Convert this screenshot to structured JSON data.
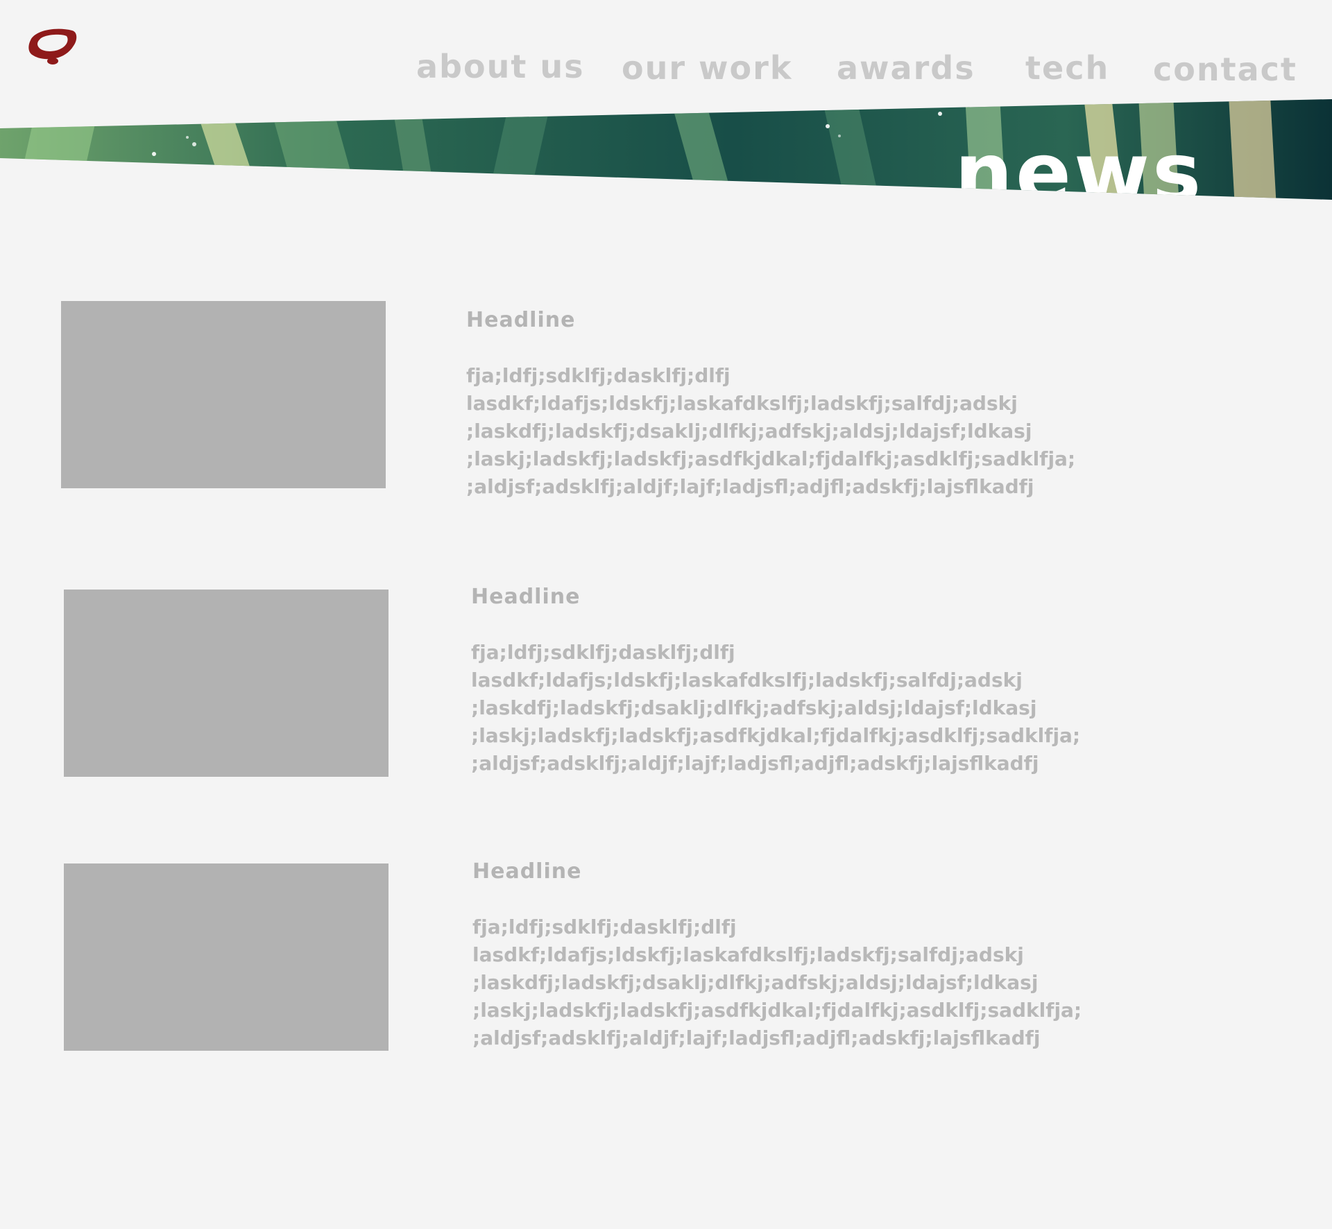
{
  "brand": {
    "logo_icon": "red-ring-logo-icon",
    "logo_color": "#8e1a1a"
  },
  "nav": {
    "items": [
      {
        "label": "about us"
      },
      {
        "label": "our work"
      },
      {
        "label": "awards"
      },
      {
        "label": "tech"
      },
      {
        "label": "contact"
      }
    ],
    "color": "#c9c9c9"
  },
  "banner": {
    "title": "news",
    "colors": [
      "#0e3b3b",
      "#2f6e55",
      "#8cc08a",
      "#e9e2a8"
    ]
  },
  "news": {
    "items": [
      {
        "headline": "Headline",
        "body": [
          "fja;ldfj;sdklfj;dasklfj;dlfj",
          "lasdkf;ldafjs;ldskfj;laskafdkslfj;ladskfj;salfdj;adskj",
          ";laskdfj;ladskfj;dsaklj;dlfkj;adfskj;aldsj;ldajsf;ldkasj",
          ";laskj;ladskfj;ladskfj;asdfkjdkal;fjdalfkj;asdklfj;sadklfja;",
          ";aldjsf;adsklfj;aldjf;lajf;ladjsfl;adjfl;adskfj;lajsflkadfj"
        ]
      },
      {
        "headline": "Headline",
        "body": [
          "fja;ldfj;sdklfj;dasklfj;dlfj",
          "lasdkf;ldafjs;ldskfj;laskafdkslfj;ladskfj;salfdj;adskj",
          ";laskdfj;ladskfj;dsaklj;dlfkj;adfskj;aldsj;ldajsf;ldkasj",
          ";laskj;ladskfj;ladskfj;asdfkjdkal;fjdalfkj;asdklfj;sadklfja;",
          ";aldjsf;adsklfj;aldjf;lajf;ladjsfl;adjfl;adskfj;lajsflkadfj"
        ]
      },
      {
        "headline": "Headline",
        "body": [
          "fja;ldfj;sdklfj;dasklfj;dlfj",
          "lasdkf;ldafjs;ldskfj;laskafdkslfj;ladskfj;salfdj;adskj",
          ";laskdfj;ladskfj;dsaklj;dlfkj;adfskj;aldsj;ldajsf;ldkasj",
          ";laskj;ladskfj;ladskfj;asdfkjdkal;fjdalfkj;asdklfj;sadklfja;",
          ";aldjsf;adsklfj;aldjf;lajf;ladjsfl;adjfl;adskfj;lajsflkadfj"
        ]
      }
    ]
  }
}
